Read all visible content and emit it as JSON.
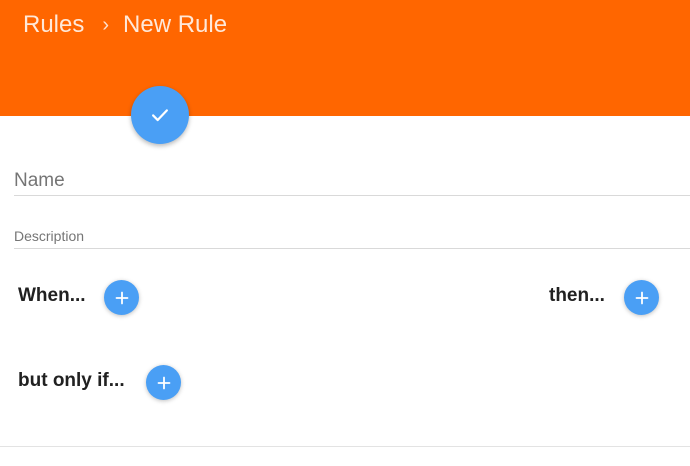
{
  "header": {
    "breadcrumb": {
      "parent": "Rules",
      "separator": "›",
      "current": "New Rule"
    },
    "background_color": "#ff6600"
  },
  "save_fab": {
    "icon": "check-icon",
    "color": "#4a9ff5"
  },
  "form": {
    "name_placeholder": "Name",
    "description_placeholder": "Description"
  },
  "rule": {
    "when_label": "When...",
    "then_label": "then...",
    "only_if_label": "but only if...",
    "add_icon": "plus-icon",
    "button_color": "#4a9ff5"
  }
}
